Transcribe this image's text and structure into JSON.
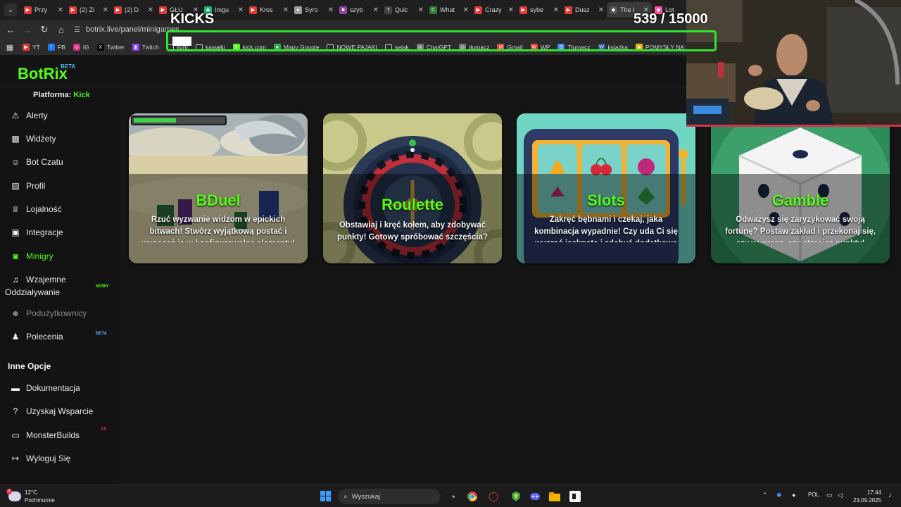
{
  "browser": {
    "tabs": [
      {
        "label": "Przy",
        "color": "#e53935",
        "glyph": "▶"
      },
      {
        "label": "(2) Zi",
        "color": "#e53935",
        "glyph": "▶"
      },
      {
        "label": "(2) D",
        "color": "#e53935",
        "glyph": "▶"
      },
      {
        "label": "GŁU",
        "color": "#e53935",
        "glyph": "▶"
      },
      {
        "label": "Imgu",
        "color": "#1bb76e",
        "glyph": "◆"
      },
      {
        "label": "Kros",
        "color": "#e53935",
        "glyph": "▶"
      },
      {
        "label": "Syro",
        "color": "#9e9e9e",
        "glyph": "●"
      },
      {
        "label": "szyb",
        "color": "#8e44ad",
        "glyph": "■"
      },
      {
        "label": "Quic",
        "color": "#444444",
        "glyph": "?"
      },
      {
        "label": "What",
        "color": "#2e7d32",
        "glyph": "C"
      },
      {
        "label": "Crazy",
        "color": "#e53935",
        "glyph": "▶"
      },
      {
        "label": "sybe",
        "color": "#e53935",
        "glyph": "▶"
      },
      {
        "label": "Dusz",
        "color": "#e53935",
        "glyph": "▶"
      },
      {
        "label": "The I",
        "color": "#555555",
        "glyph": "◆",
        "active": true
      },
      {
        "label": "Lot",
        "color": "#ff4fa3",
        "glyph": "◆"
      }
    ],
    "url": "botrix.live/panel/minigames",
    "bookmarks": [
      {
        "label": "YT",
        "color": "#e53935",
        "glyph": "▶"
      },
      {
        "label": "FB",
        "color": "#1877f2",
        "glyph": "f"
      },
      {
        "label": "IG",
        "color": "#d62976",
        "glyph": "◎"
      },
      {
        "label": "Twitter",
        "color": "#000000",
        "glyph": "X"
      },
      {
        "label": "Twitch",
        "color": "#9146ff",
        "glyph": "▮"
      },
      {
        "label": "sum",
        "color": "",
        "glyph": "folder"
      },
      {
        "label": "kawałki",
        "color": "",
        "glyph": "folder"
      },
      {
        "label": "kick.com",
        "color": "#53fc18",
        "glyph": "K"
      },
      {
        "label": "Mapy Google",
        "color": "#34a853",
        "glyph": "●"
      },
      {
        "label": "NOWE PAJAKI",
        "color": "",
        "glyph": "folder"
      },
      {
        "label": "sejak",
        "color": "",
        "glyph": "folder"
      },
      {
        "label": "ChatGPT",
        "color": "#777777",
        "glyph": "◎"
      },
      {
        "label": "tłumacz",
        "color": "#777777",
        "glyph": "◎"
      },
      {
        "label": "Gmail",
        "color": "#ea4335",
        "glyph": "M"
      },
      {
        "label": "WP",
        "color": "#e53935",
        "glyph": "W"
      },
      {
        "label": "Tłumacz",
        "color": "#4285f4",
        "glyph": "G"
      },
      {
        "label": "książka",
        "color": "#2b579a",
        "glyph": "W"
      },
      {
        "label": "POMYSŁY NA STRE",
        "color": "#f4b400",
        "glyph": "■"
      }
    ]
  },
  "overlay": {
    "title": "KICKS",
    "count": "539",
    "goal": "/ 15000",
    "progress_fraction": 0.036,
    "border_color": "#2ee52e"
  },
  "app": {
    "logo": "BotRix",
    "beta_label": "BETA",
    "platform_label": "Platforma:",
    "platform_value": "Kick",
    "accent": "#53fc18",
    "nav": [
      {
        "icon": "alert-icon",
        "glyph": "⚠",
        "label": "Alerty"
      },
      {
        "icon": "widgets-icon",
        "glyph": "▦",
        "label": "Widżety"
      },
      {
        "icon": "robot-icon",
        "glyph": "☺",
        "label": "Bot Czatu"
      },
      {
        "icon": "id-card-icon",
        "glyph": "▤",
        "label": "Profil"
      },
      {
        "icon": "trophy-icon",
        "glyph": "♕",
        "label": "Lojalność"
      },
      {
        "icon": "puzzle-icon",
        "glyph": "▣",
        "label": "Integracje"
      },
      {
        "icon": "gamepad-icon",
        "glyph": "◙",
        "label": "Minigry",
        "active": true
      },
      {
        "icon": "music-icon",
        "glyph": "♫",
        "label": "Wzajemne",
        "label2": "Oddziaływanie",
        "tag": "NOWY"
      },
      {
        "icon": "users-icon",
        "glyph": "☻",
        "label": "Podużytkownicy",
        "disabled": true
      },
      {
        "icon": "referral-icon",
        "glyph": "♟",
        "label": "Polecenia",
        "tag": "BETA"
      }
    ],
    "section_title": "Inne Opcje",
    "other": [
      {
        "icon": "book-icon",
        "glyph": "▬",
        "label": "Dokumentacja"
      },
      {
        "icon": "help-icon",
        "glyph": "?",
        "label": "Uzyskaj Wsparcie"
      },
      {
        "icon": "laptop-icon",
        "glyph": "▭",
        "label": "MonsterBuilds",
        "tag": "AD"
      },
      {
        "icon": "logout-icon",
        "glyph": "↦",
        "label": "Wyloguj Się"
      }
    ]
  },
  "games": [
    {
      "title": "BDuel",
      "description": "Rzuć wyzwanie widzom w epickich bitwach! Stwórz wyjątkową postać i wyposaż ją w konfigurowalne elementy!"
    },
    {
      "title": "Roulette",
      "description": "Obstawiaj i kręć kołem, aby zdobywać punkty! Gotowy spróbować szczęścia?"
    },
    {
      "title": "Slots",
      "description": "Zakręć bębnami i czekaj, jaka kombinacja wypadnie! Czy uda Ci się wygrać jackpota i zdobyć dodatkowe punkty?"
    },
    {
      "title": "Gamble",
      "description": "Odważysz się zaryzykować swoją fortunę? Postaw zakład i przekonaj się, czy wygrasz, czy stracisz punkty!"
    }
  ],
  "taskbar": {
    "temperature": "12°C",
    "weather": "Pochmurnie",
    "weather_badge": "3",
    "search_placeholder": "Wyszukaj",
    "language": "POL",
    "time": "17:44",
    "date": "23.09.2025"
  }
}
